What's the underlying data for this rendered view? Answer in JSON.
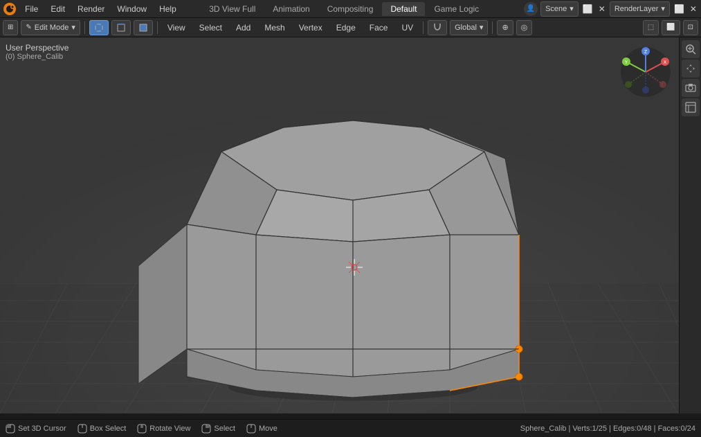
{
  "app": {
    "title": "Blender",
    "logo": "🔷"
  },
  "topmenu": {
    "items": [
      "File",
      "Edit",
      "Render",
      "Window",
      "Help"
    ],
    "workspace_tabs": [
      {
        "label": "3D View Full",
        "active": false
      },
      {
        "label": "Animation",
        "active": false
      },
      {
        "label": "Compositing",
        "active": false
      },
      {
        "label": "Default",
        "active": true
      },
      {
        "label": "Game Logic",
        "active": false
      }
    ],
    "scene": "Scene",
    "render_layer": "RenderLayer"
  },
  "toolbar": {
    "mode_label": "Edit Mode",
    "view_label": "View",
    "select_label": "Select",
    "add_label": "Add",
    "mesh_label": "Mesh",
    "vertex_label": "Vertex",
    "edge_label": "Edge",
    "face_label": "Face",
    "uv_label": "UV",
    "global_label": "Global",
    "select_mode_buttons": [
      "vertex",
      "edge",
      "face"
    ],
    "proportional_label": "Proportional Edit"
  },
  "viewport": {
    "perspective": "User Perspective",
    "object_name": "(0) Sphere_Calib",
    "background_color": "#3a3a3a",
    "grid_color": "#4a4a4a",
    "axis_x_color": "#b41e1e",
    "axis_y_color": "#78b41e"
  },
  "gizmo": {
    "x_color": "#e05050",
    "y_color": "#80cc40",
    "z_color": "#5080e0",
    "x_label": "X",
    "y_label": "Y",
    "z_label": "Z"
  },
  "right_tools": {
    "buttons": [
      {
        "icon": "🔍",
        "name": "zoom-icon"
      },
      {
        "icon": "✋",
        "name": "pan-icon"
      },
      {
        "icon": "🎥",
        "name": "camera-icon"
      },
      {
        "icon": "📷",
        "name": "render-icon"
      }
    ]
  },
  "statusbar": {
    "cursor_label": "Set 3D Cursor",
    "box_select_label": "Box Select",
    "rotate_label": "Rotate View",
    "select_label": "Select",
    "move_label": "Move",
    "object_name": "Sphere_Calib",
    "verts": "Verts:1/25",
    "edges": "Edges:0/48",
    "faces": "Faces:0/24"
  }
}
